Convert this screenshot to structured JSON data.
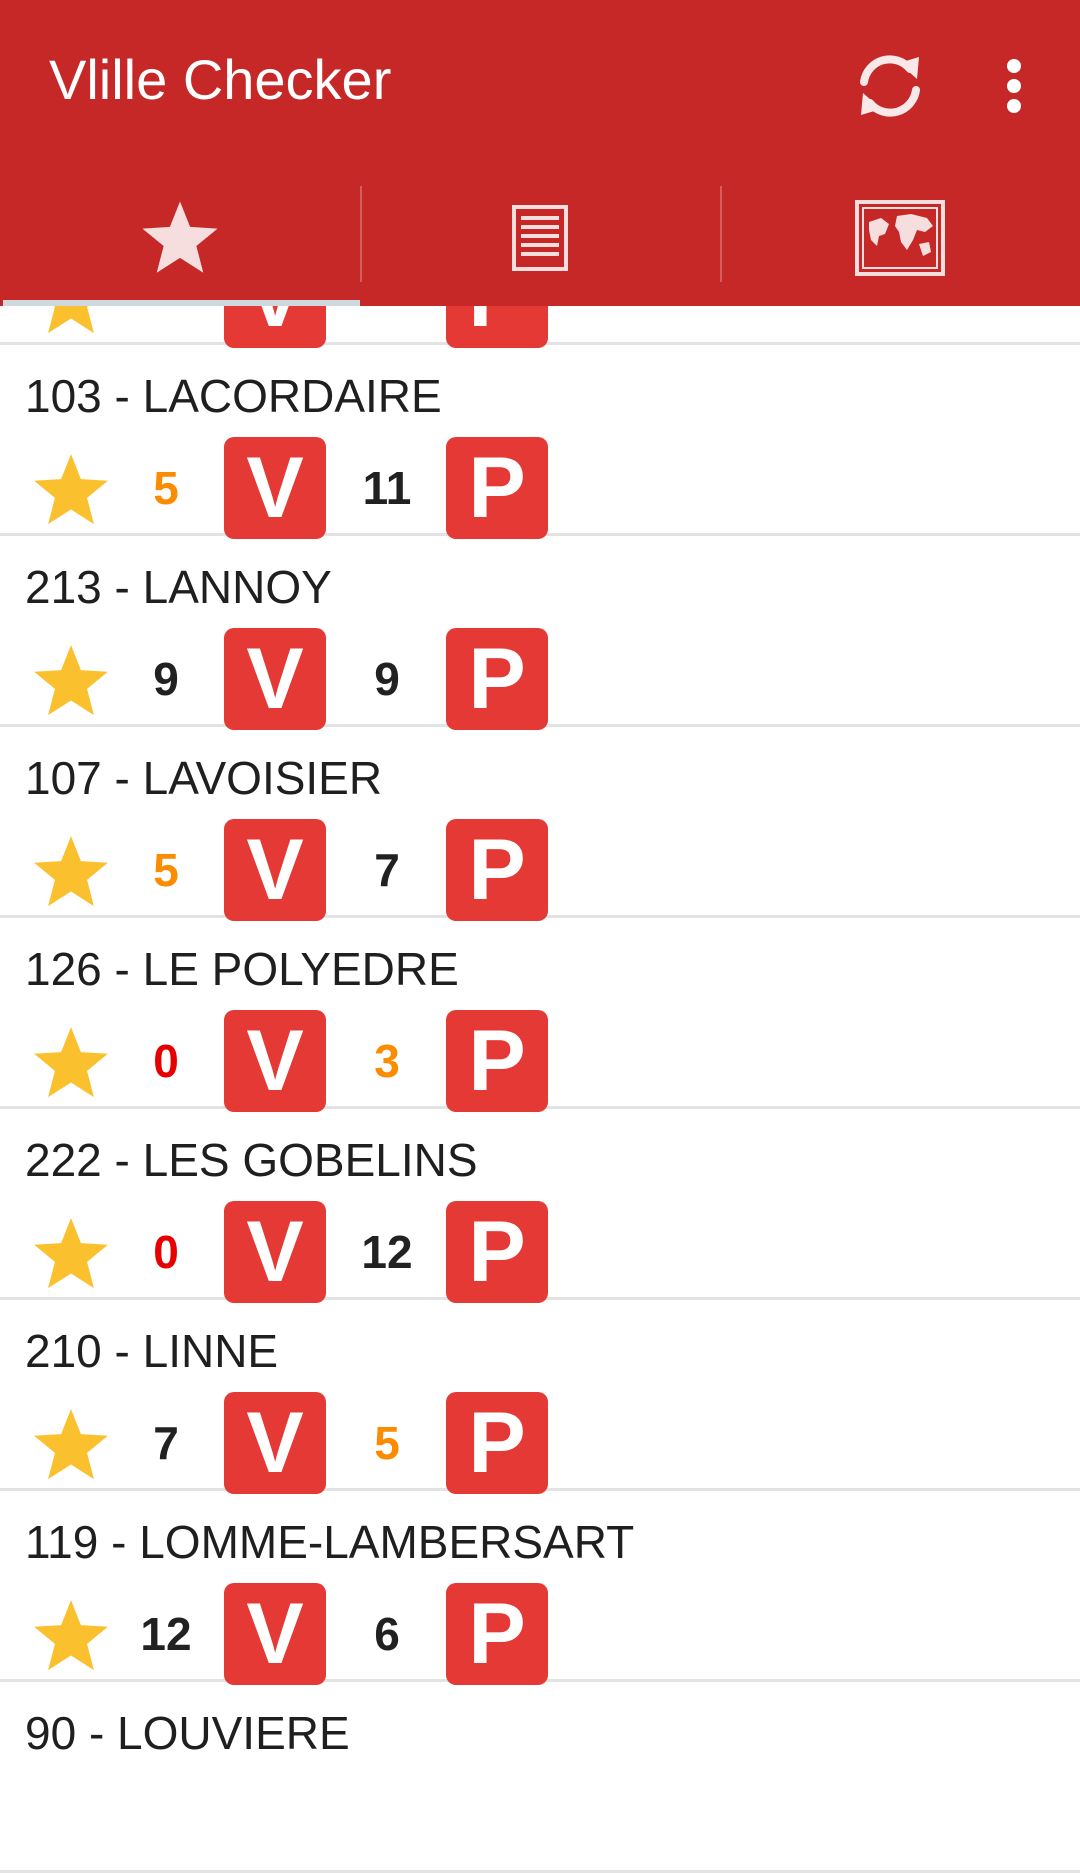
{
  "app": {
    "title": "Vlille Checker",
    "refresh_icon": "refresh-icon",
    "menu_icon": "more-vert-icon",
    "primary_color": "#c62828"
  },
  "tabs": [
    {
      "name": "favorites",
      "icon": "star-icon",
      "selected": true
    },
    {
      "name": "list",
      "icon": "list-icon",
      "selected": false
    },
    {
      "name": "map",
      "icon": "world-map-icon",
      "selected": false
    }
  ],
  "badges": {
    "bikes_letter": "V",
    "parking_letter": "P",
    "color": "#e53935"
  },
  "status_colors": {
    "ok": "#212121",
    "low": "#fb8c00",
    "empty": "#e60000"
  },
  "stations": [
    {
      "name": "",
      "bikes": "",
      "stands": "",
      "bikes_status": "ok",
      "stands_status": "ok"
    },
    {
      "name": "103 - LACORDAIRE",
      "bikes": "5",
      "stands": "11",
      "bikes_status": "low",
      "stands_status": "ok"
    },
    {
      "name": "213 - LANNOY",
      "bikes": "9",
      "stands": "9",
      "bikes_status": "ok",
      "stands_status": "ok"
    },
    {
      "name": "107 - LAVOISIER",
      "bikes": "5",
      "stands": "7",
      "bikes_status": "low",
      "stands_status": "ok"
    },
    {
      "name": "126 - LE POLYEDRE",
      "bikes": "0",
      "stands": "3",
      "bikes_status": "empty",
      "stands_status": "low"
    },
    {
      "name": "222 - LES GOBELINS",
      "bikes": "0",
      "stands": "12",
      "bikes_status": "empty",
      "stands_status": "ok"
    },
    {
      "name": "210 - LINNE",
      "bikes": "7",
      "stands": "5",
      "bikes_status": "ok",
      "stands_status": "low"
    },
    {
      "name": "119 - LOMME-LAMBERSART",
      "bikes": "12",
      "stands": "6",
      "bikes_status": "ok",
      "stands_status": "ok"
    },
    {
      "name": "90 - LOUVIERE",
      "bikes": "",
      "stands": "",
      "bikes_status": "ok",
      "stands_status": "ok"
    }
  ]
}
